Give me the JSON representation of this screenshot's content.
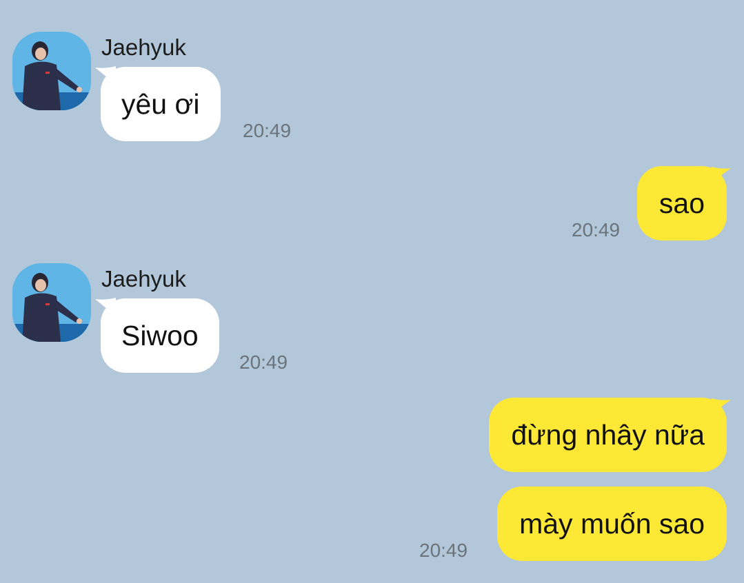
{
  "colors": {
    "background": "#b2c7da",
    "incoming_bubble": "#ffffff",
    "outgoing_bubble": "#fee836",
    "timestamp": "#6b737b"
  },
  "messages": [
    {
      "sender": "Jaehyuk",
      "text": "yêu ơi",
      "time": "20:49"
    },
    {
      "text": "sao",
      "time": "20:49"
    },
    {
      "sender": "Jaehyuk",
      "text": "Siwoo",
      "time": "20:49"
    },
    {
      "text": "đừng nhây nữa"
    },
    {
      "text": "mày muốn sao",
      "time": "20:49"
    }
  ]
}
